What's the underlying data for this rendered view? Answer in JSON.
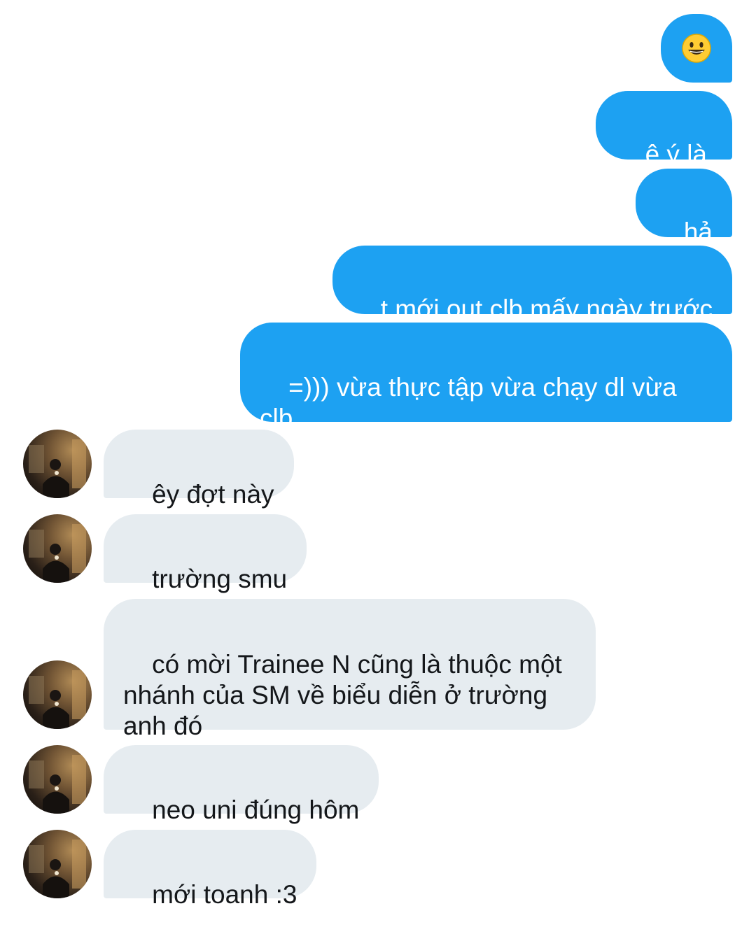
{
  "conversation": {
    "sent": [
      {
        "text": "",
        "emoji": "grinning-face"
      },
      {
        "text": "ê ý là"
      },
      {
        "text": "hả"
      },
      {
        "text": "t mới out clb mấy ngày trước"
      },
      {
        "text": "=))) vừa thực tập vừa chạy dl vừa clb\nsao cho nổi hả em"
      }
    ],
    "received": [
      {
        "text": "êy đợt này"
      },
      {
        "text": "trường smu"
      },
      {
        "text": "có mời Trainee N cũng là thuộc một\nnhánh của SM về biểu diễn ở trường\nanh đó"
      },
      {
        "text": "neo uni đúng hôm"
      },
      {
        "text": "mới toanh :3"
      }
    ]
  },
  "colors": {
    "sent_bubble": "#1da1f2",
    "sent_text": "#ffffff",
    "received_bubble": "#e6ecf0",
    "received_text": "#14171a",
    "background": "#ffffff"
  }
}
